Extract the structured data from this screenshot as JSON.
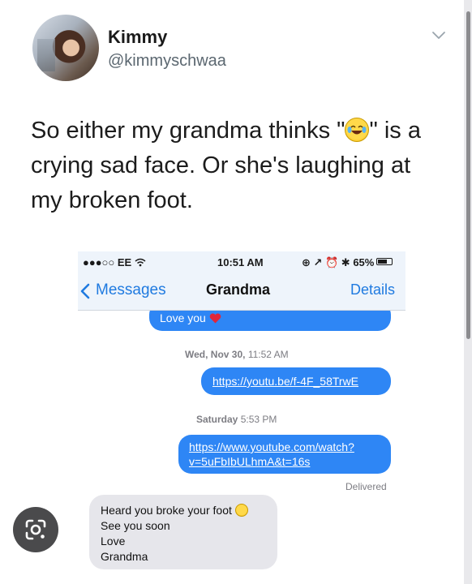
{
  "tweet": {
    "display_name": "Kimmy",
    "handle": "@kimmyschwaa",
    "text_part1": "So either my grandma thinks \"",
    "emoji_name": "laughing-tears-emoji",
    "text_part2": "\" is a crying sad face. Or she's laughing at my broken foot."
  },
  "phone": {
    "status_bar": {
      "carrier": "●●●○○ EE",
      "time": "10:51 AM",
      "battery": "65%"
    },
    "nav": {
      "back_label": "Messages",
      "title": "Grandma",
      "details_label": "Details"
    },
    "messages": [
      {
        "type": "outgoing",
        "text": "Love you"
      },
      {
        "type": "timestamp",
        "day": "Wed, Nov 30,",
        "time": "11:52 AM"
      },
      {
        "type": "outgoing",
        "text": "https://youtu.be/f-4F_58TrwE"
      },
      {
        "type": "timestamp",
        "day": "Saturday",
        "time": "5:53 PM"
      },
      {
        "type": "outgoing",
        "line1": "https://www.youtube.com/watch?",
        "line2": "v=5uFbIbULhmA&t=16s"
      },
      {
        "type": "status",
        "text": "Delivered"
      },
      {
        "type": "incoming",
        "line1": "Heard you broke your foot",
        "line2": "See you soon",
        "line3": "Love",
        "line4": "Grandma"
      }
    ]
  },
  "colors": {
    "ios_blue": "#2e86f5",
    "link_blue": "#1f7ae0",
    "incoming_gray": "#e6e6eb",
    "nav_bg": "#eef4fb"
  },
  "icons": [
    "chevron-down-icon",
    "wifi-icon",
    "back-chevron-icon",
    "heart-emoji",
    "laughing-tears-emoji",
    "lens-icon"
  ]
}
